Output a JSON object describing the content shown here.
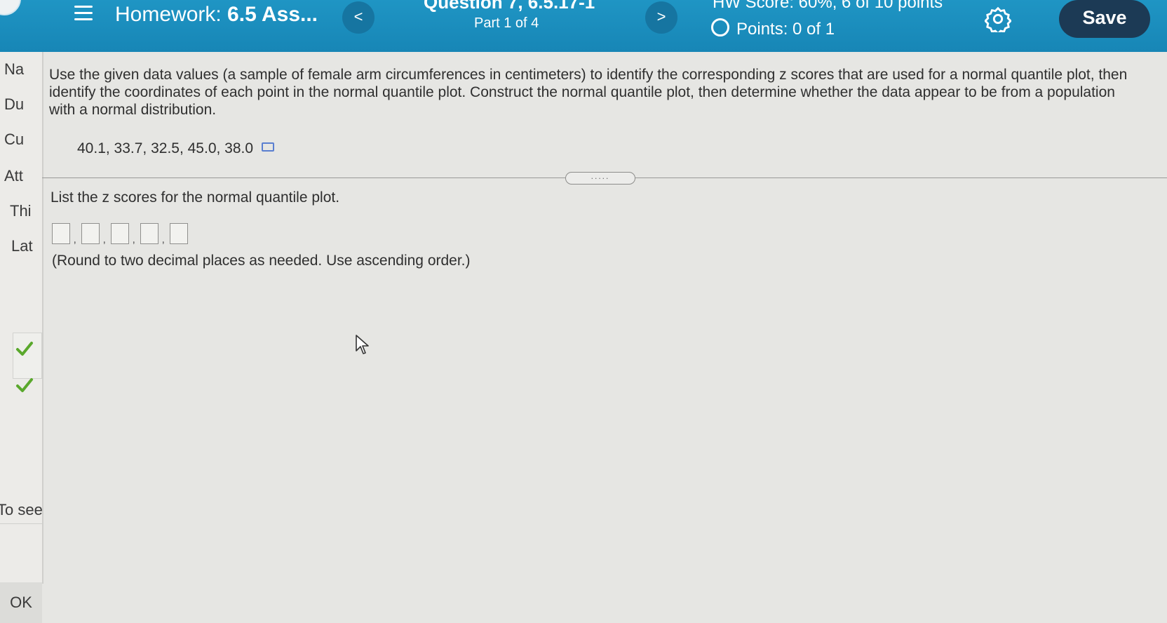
{
  "header": {
    "menu_icon": "hamburger-menu-icon",
    "homework_prefix": "Homework:",
    "homework_name": "6.5 Ass...",
    "prev_label": "<",
    "question_title": "Question 7, 6.5.17-1",
    "part": "Part 1 of 4",
    "next_label": ">",
    "hw_score": "HW Score: 60%, 6 of 10 points",
    "points": "Points: 0 of 1",
    "settings_icon": "gear-icon",
    "save_label": "Save"
  },
  "sidebar": {
    "items": [
      "Na",
      "Du",
      "Cu",
      "Att",
      "Thi",
      "Lat"
    ],
    "to_see_text": "To see",
    "ok_label": "OK"
  },
  "question": {
    "instructions": "Use the given data values (a sample of female arm circumferences in centimeters) to identify the corresponding z scores that are used for a normal quantile plot, then identify the coordinates of each point in the normal quantile plot. Construct the normal quantile plot, then determine whether the data appear to be from a population with a normal distribution.",
    "data_values": "40.1, 33.7, 32.5, 45.0, 38.0",
    "prompt": "List the z scores for the normal quantile plot.",
    "answer_count": 5,
    "note": "(Round to two decimal places as needed. Use ascending order.)"
  },
  "colors": {
    "header_bg": "#1b8ebf",
    "save_bg": "#1c3a55",
    "check_green": "#5aa82c",
    "page_bg": "#e6e6e3"
  }
}
